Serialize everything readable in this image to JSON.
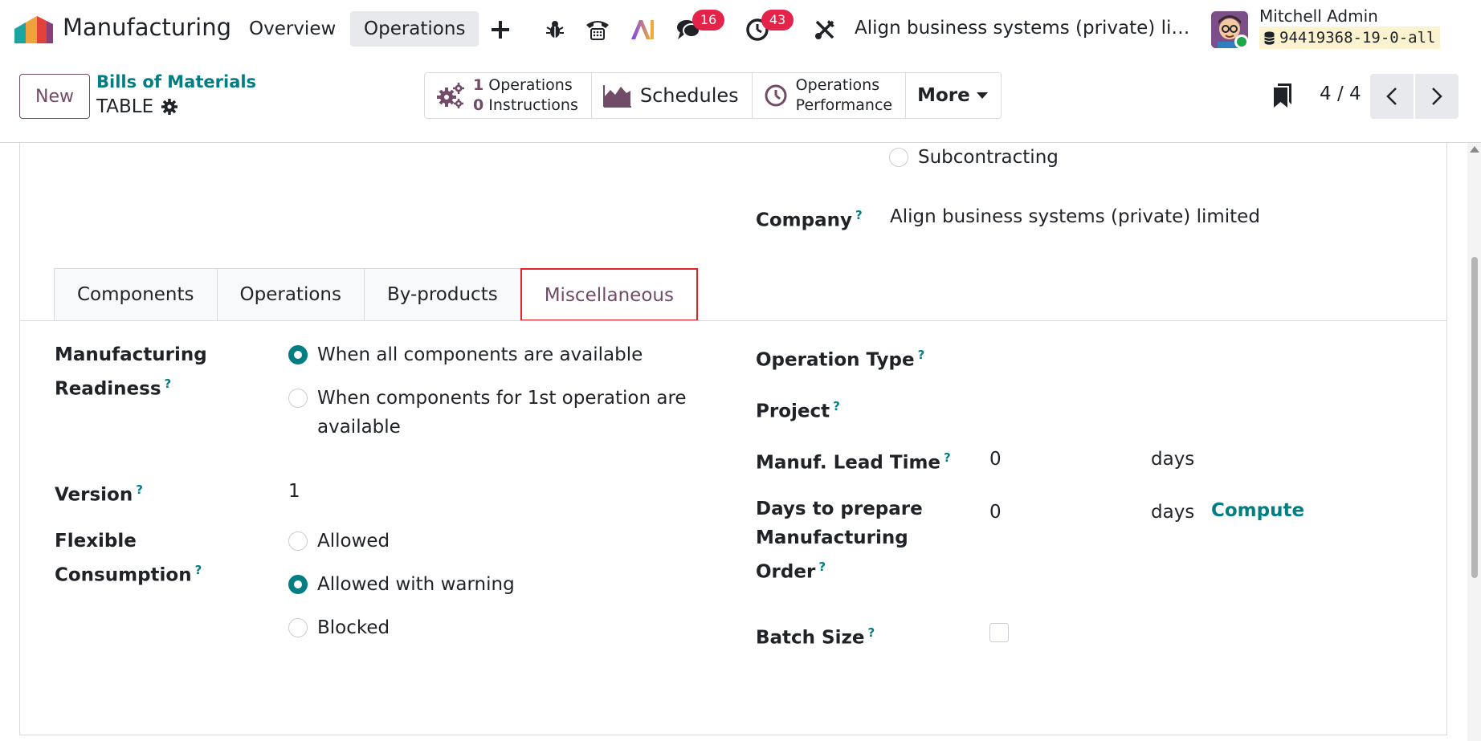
{
  "navbar": {
    "app_name": "Manufacturing",
    "menu": [
      "Overview",
      "Operations"
    ],
    "active_menu": "Operations",
    "messages_count": "16",
    "activities_count": "43",
    "company": "Align business systems (private) lim...",
    "user_name": "Mitchell Admin",
    "database": "94419368-19-0-all"
  },
  "control_panel": {
    "new_label": "New",
    "breadcrumb": "Bills of Materials",
    "record_name": "TABLE",
    "smart_buttons": {
      "operations_count": "1",
      "operations_label": "Operations",
      "instructions_count": "0",
      "instructions_label": "Instructions",
      "schedules_label": "Schedules",
      "performance_line1": "Operations",
      "performance_line2": "Performance",
      "more_label": "More"
    },
    "pager": "4 / 4"
  },
  "form": {
    "bom_type_option": "Subcontracting",
    "company_label": "Company",
    "company_value": "Align business systems (private) limited",
    "tabs": [
      "Components",
      "Operations",
      "By-products",
      "Miscellaneous"
    ],
    "active_tab": "Miscellaneous",
    "left": {
      "readiness_label_1": "Manufacturing",
      "readiness_label_2": "Readiness",
      "readiness_options": [
        "When all components are available",
        "When components for 1st operation are",
        "available"
      ],
      "readiness_selected": "When all components are available",
      "version_label": "Version",
      "version_value": "1",
      "flex_label_1": "Flexible",
      "flex_label_2": "Consumption",
      "flex_options": [
        "Allowed",
        "Allowed with warning",
        "Blocked"
      ],
      "flex_selected": "Allowed with warning"
    },
    "right": {
      "operation_type_label": "Operation Type",
      "project_label": "Project",
      "lead_time_label": "Manuf. Lead Time",
      "lead_time_value": "0",
      "lead_time_unit": "days",
      "days_prepare_label_1": "Days to prepare",
      "days_prepare_label_2": "Manufacturing",
      "days_prepare_label_3": "Order",
      "days_prepare_value": "0",
      "days_prepare_unit": "days",
      "compute_label": "Compute",
      "batch_size_label": "Batch Size",
      "batch_size_checked": false
    }
  },
  "colors": {
    "brand": "#714b67",
    "accent": "#017e84",
    "badge": "#e3234a",
    "highlight_border": "#e3212b"
  }
}
